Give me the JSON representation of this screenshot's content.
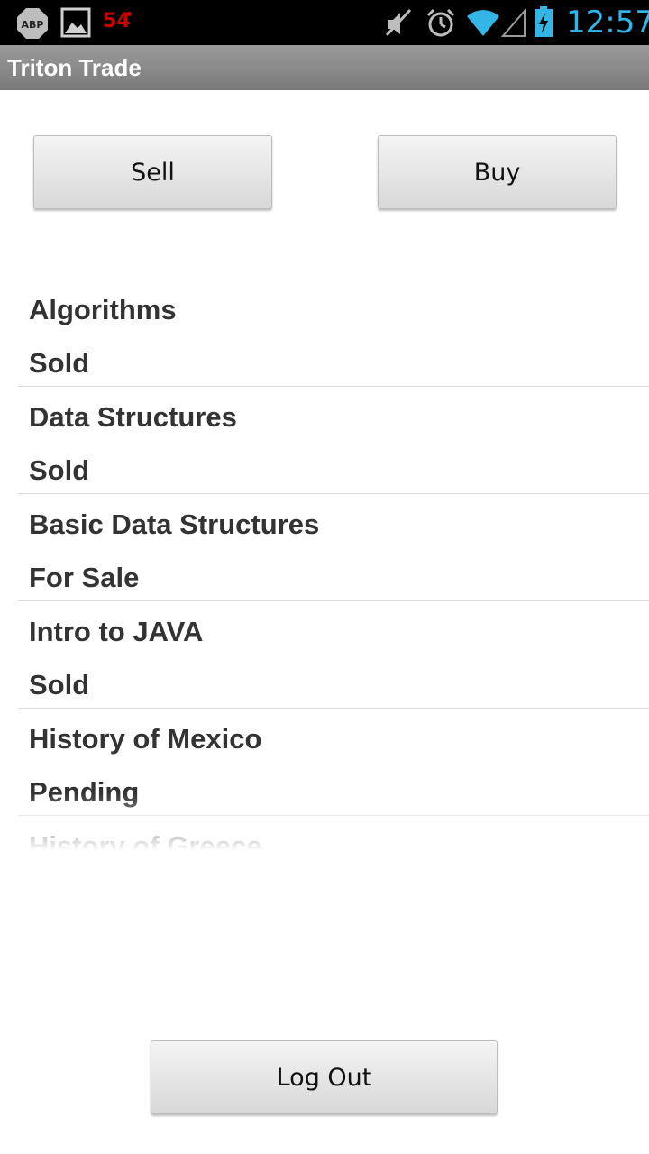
{
  "status_bar": {
    "temperature": "54",
    "time": "12:57",
    "icons": [
      "adblock-icon",
      "picture-icon",
      "mute-icon",
      "alarm-icon",
      "wifi-icon",
      "signal-icon",
      "battery-charging-icon"
    ],
    "time_color": "#33b5e5",
    "temperature_color": "#c80000"
  },
  "app": {
    "title": "Triton Trade"
  },
  "actions": {
    "sell_label": "Sell",
    "buy_label": "Buy",
    "logout_label": "Log Out"
  },
  "books": [
    {
      "title": "Algorithms",
      "status": "Sold"
    },
    {
      "title": "Data Structures",
      "status": "Sold"
    },
    {
      "title": "Basic Data Structures",
      "status": "For Sale"
    },
    {
      "title": "Intro to JAVA",
      "status": "Sold"
    },
    {
      "title": "History of Mexico",
      "status": "Pending"
    },
    {
      "title": "History of Greece",
      "status": ""
    }
  ]
}
